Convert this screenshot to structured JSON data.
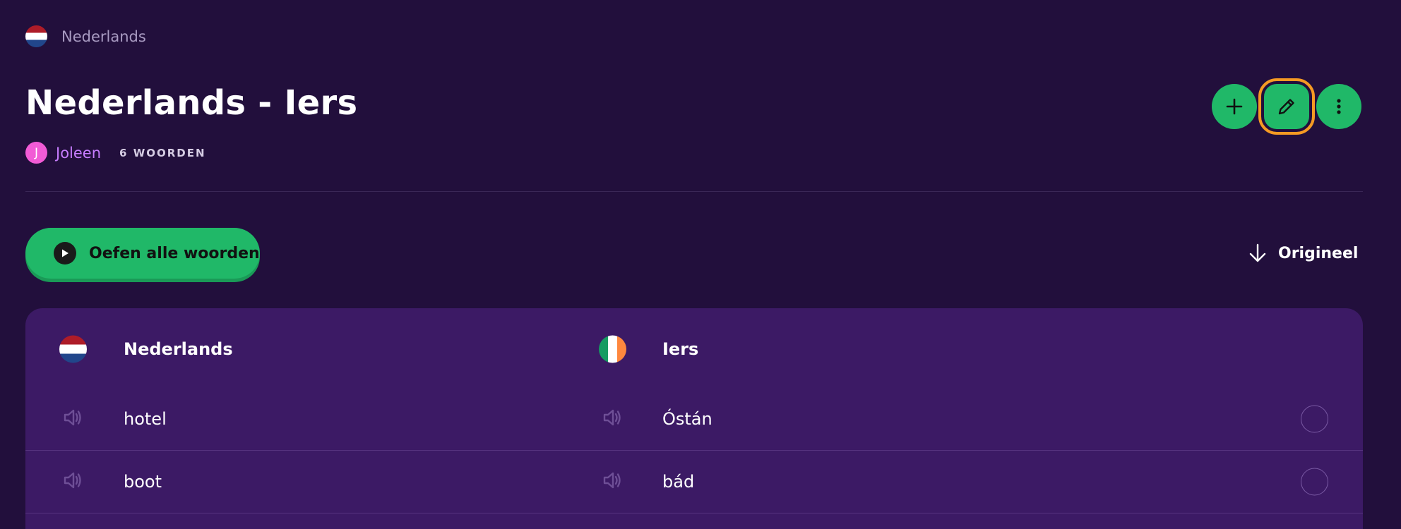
{
  "breadcrumb": {
    "label": "Nederlands",
    "flag": "nl-flag-icon"
  },
  "header": {
    "title": "Nederlands - Iers",
    "author_initial": "J",
    "author": "Joleen",
    "word_count": "6 WOORDEN"
  },
  "actions": {
    "add": "plus-icon",
    "edit": "pencil-icon",
    "more": "more-vertical-icon"
  },
  "practice": {
    "label": "Oefen alle woorden"
  },
  "sort": {
    "label": "Origineel"
  },
  "table": {
    "header": {
      "source": "Nederlands",
      "target": "Iers"
    },
    "rows": [
      {
        "source": "hotel",
        "target": "Óstán"
      },
      {
        "source": "boot",
        "target": "bád"
      }
    ]
  },
  "colors": {
    "background": "#220f3c",
    "card": "#3c1a65",
    "accent_green": "#20b868",
    "highlight_orange": "#f59a23",
    "author_purple": "#c77dff",
    "avatar_pink": "#f25bd6"
  }
}
